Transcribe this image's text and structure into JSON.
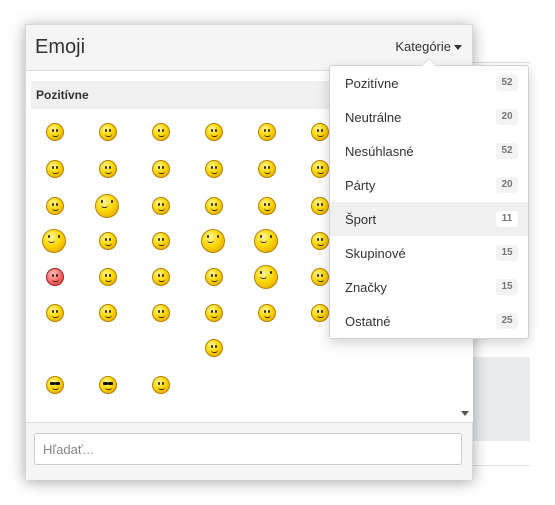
{
  "panel": {
    "title": "Emoji",
    "category_toggle_label": "Kategórie",
    "section_label": "Pozitívne",
    "search_placeholder": "Hľadať..."
  },
  "categories": [
    {
      "label": "Pozitívne",
      "count": "52",
      "active": false
    },
    {
      "label": "Neutrálne",
      "count": "20",
      "active": false
    },
    {
      "label": "Nesúhlasné",
      "count": "52",
      "active": false
    },
    {
      "label": "Párty",
      "count": "20",
      "active": false
    },
    {
      "label": "Šport",
      "count": "11",
      "active": true
    },
    {
      "label": "Skupinové",
      "count": "15",
      "active": false
    },
    {
      "label": "Značky",
      "count": "15",
      "active": false
    },
    {
      "label": "Ostatné",
      "count": "25",
      "active": false
    }
  ],
  "emoji_rows": [
    [
      "smile-icon",
      "smile-icon",
      "smile-icon",
      "smile-icon",
      "tongue-icon",
      "smile-icon"
    ],
    [
      "smile-icon",
      "sweat-smile-icon",
      "smile-icon",
      "rolling-eyes-icon",
      "smirk-icon",
      "angel-icon"
    ],
    [
      "wink-icon",
      "flower-smile-icon",
      "smile-icon",
      "content-icon",
      "grin-icon",
      "hat-smile-icon"
    ],
    [
      "banner-smile-icon",
      "thumbs-up-icon",
      "dancing-icon",
      "cheering-icon",
      "arms-up-icon",
      "grin-icon"
    ],
    [
      "hearts-blush-icon",
      "kiss-icon",
      "star-eyes-icon",
      "blush-icon",
      "flower-head-icon",
      "sun-cool-icon"
    ],
    [
      "laugh-icon",
      "big-laugh-icon",
      "laugh-tears-icon",
      "tongue-laugh-icon",
      "halo-icon",
      "headband-icon"
    ],
    [
      "",
      "",
      "",
      "big-grin-icon",
      "",
      ""
    ],
    [
      "sunglasses-icon",
      "cool-icon",
      "wings-icon",
      "",
      "",
      ""
    ]
  ],
  "colors": {
    "header_bg": "#f5f5f5",
    "active_item_bg": "#f0f0f0",
    "emoji_yellow": "#ffd800"
  }
}
